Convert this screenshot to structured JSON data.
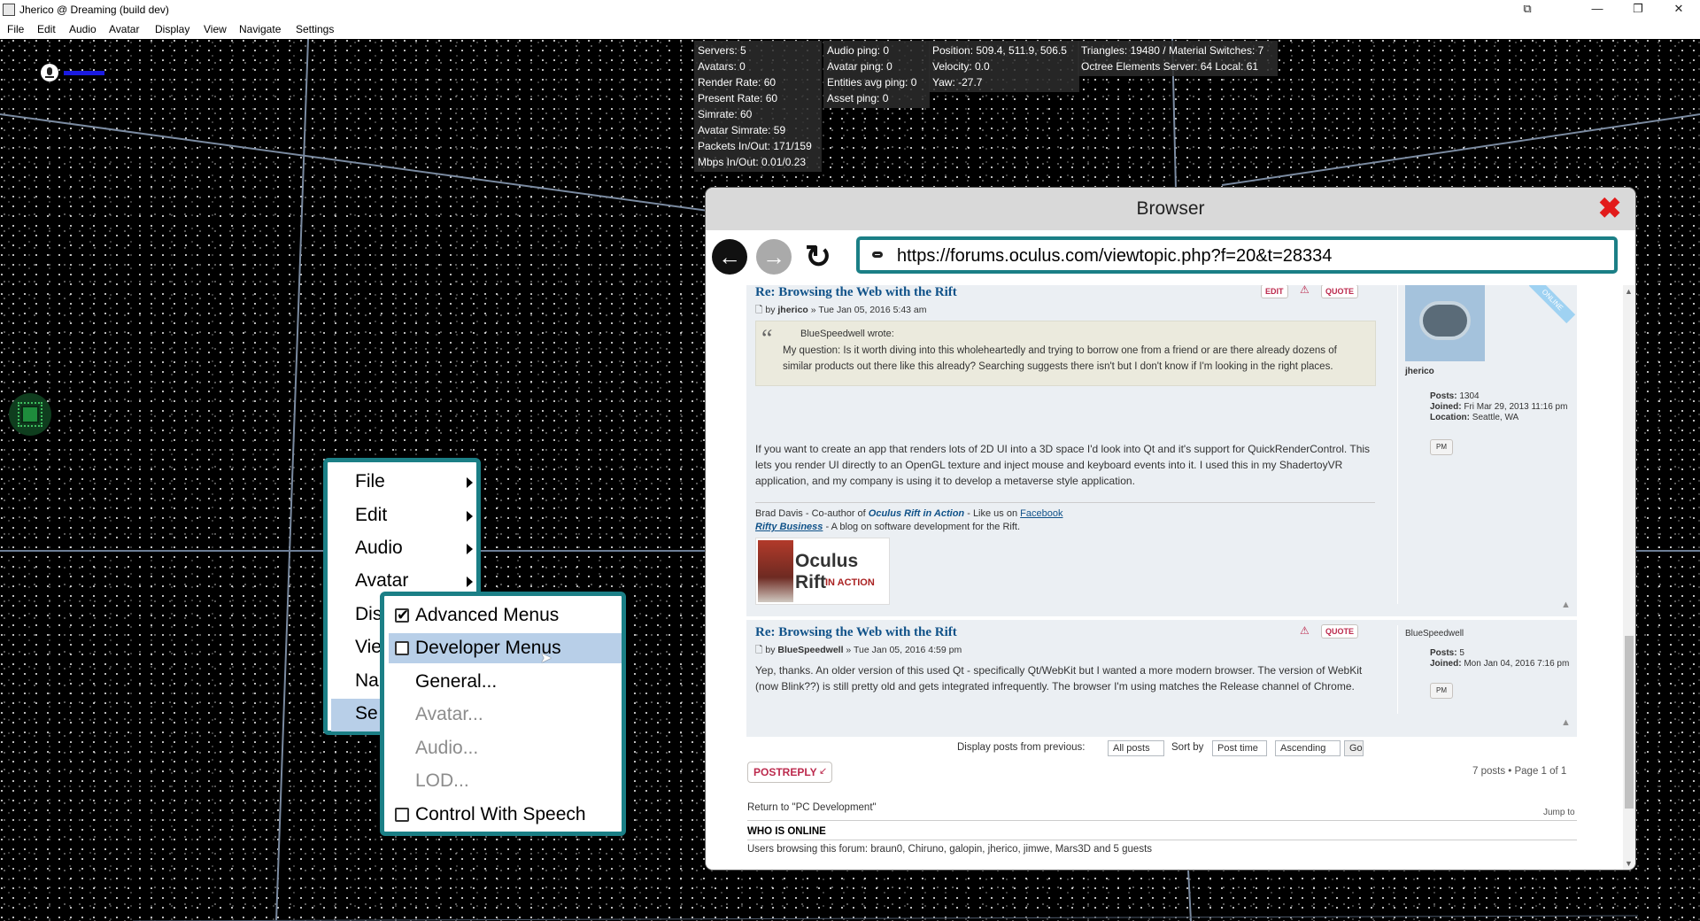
{
  "window": {
    "title": "Jherico @ Dreaming (build dev)",
    "controls": {
      "restore_alt": "⧉",
      "minimize": "—",
      "maximize": "❐",
      "close": "✕"
    }
  },
  "menubar": [
    "File",
    "Edit",
    "Audio",
    "Avatar",
    "Display",
    "View",
    "Navigate",
    "Settings"
  ],
  "stats": {
    "box1": [
      "Servers: 5",
      "Avatars: 0",
      "Render Rate: 60",
      "Present Rate: 60",
      "Simrate: 60",
      "Avatar Simrate: 59",
      "Packets In/Out: 171/159",
      "Mbps In/Out: 0.01/0.23"
    ],
    "box2": [
      "Audio ping: 0",
      "Avatar ping: 0",
      "Entities avg ping: 0",
      "Asset ping: 0"
    ],
    "box3": [
      "Position: 509.4, 511.9, 506.5",
      "Velocity: 0.0",
      "Yaw: -27.7"
    ],
    "box4": [
      "Triangles: 19480 / Material Switches: 7",
      "Octree Elements Server: 64 Local: 61"
    ]
  },
  "main_menu": {
    "items": [
      {
        "label": "File"
      },
      {
        "label": "Edit"
      },
      {
        "label": "Audio"
      },
      {
        "label": "Avatar"
      },
      {
        "label": "Dis"
      },
      {
        "label": "Vie"
      },
      {
        "label": "Na"
      },
      {
        "label": "Se"
      }
    ]
  },
  "settings_submenu": {
    "items": [
      {
        "label": "Advanced Menus",
        "checkbox": true,
        "checked": true,
        "enabled": true
      },
      {
        "label": "Developer Menus",
        "checkbox": true,
        "checked": false,
        "enabled": true,
        "highlighted": true
      },
      {
        "label": "General...",
        "checkbox": false,
        "enabled": true
      },
      {
        "label": "Avatar...",
        "checkbox": false,
        "enabled": false
      },
      {
        "label": "Audio...",
        "checkbox": false,
        "enabled": false
      },
      {
        "label": "LOD...",
        "checkbox": false,
        "enabled": false
      },
      {
        "label": "Control With Speech",
        "checkbox": true,
        "checked": false,
        "enabled": true
      }
    ]
  },
  "browser": {
    "title": "Browser",
    "url": "https://forums.oculus.com/viewtopic.php?f=20&t=28334",
    "post1": {
      "title": "Re: Browsing the Web with the Rift",
      "by": "by",
      "author": "jherico",
      "date": "» Tue Jan 05, 2016 5:43 am",
      "edit_label": "EDIT",
      "quote_label": "QUOTE",
      "quote_author": "BlueSpeedwell wrote:",
      "quote_text": "My question: Is it worth diving into this wholeheartedly and trying to borrow one from a friend or are there already dozens of similar products out there like this already? Searching suggests there isn't but I don't know if I'm looking in the right places.",
      "body": "If you want to create an app that renders lots of 2D UI into a 3D space I'd look into Qt and it's support for QuickRenderControl. This lets you render UI directly to an OpenGL texture and inject mouse and keyboard events into it. I used this in my ShadertoyVR application, and my company is using it to develop a metaverse style application.",
      "sig_prefix": "Brad Davis - Co-author of",
      "sig_book": "Oculus Rift in Action",
      "sig_mid": "- Like us on",
      "sig_fb": "Facebook",
      "sig_blog": "Rifty Business",
      "sig_blog_desc": "- A blog on software development for the Rift.",
      "book_title": "Oculus Rift",
      "book_sub": "IN ACTION",
      "profile": {
        "online": "ONLINE",
        "name": "jherico",
        "posts_label": "Posts:",
        "posts": "1304",
        "joined_label": "Joined:",
        "joined": "Fri Mar 29, 2013 11:16 pm",
        "location_label": "Location:",
        "location": "Seattle, WA",
        "pm": "PM"
      }
    },
    "post2": {
      "title": "Re: Browsing the Web with the Rift",
      "by": "by",
      "author": "BlueSpeedwell",
      "date": "» Tue Jan 05, 2016 4:59 pm",
      "quote_label": "QUOTE",
      "body": "Yep, thanks. An older version of this used Qt - specifically Qt/WebKit but I wanted a more modern browser. The version of WebKit (now Blink??) is still pretty old and gets integrated infrequently. The browser I'm using matches the Release channel of Chrome.",
      "profile": {
        "name": "BlueSpeedwell",
        "posts_label": "Posts:",
        "posts": "5",
        "joined_label": "Joined:",
        "joined": "Mon Jan 04, 2016 7:16 pm",
        "pm": "PM"
      }
    },
    "footer": {
      "display_label": "Display posts from previous:",
      "display_value": "All posts",
      "sort_label": "Sort by",
      "sort_value": "Post time",
      "order_value": "Ascending",
      "go": "Go",
      "postreply": "POSTREPLY",
      "pagination": "7 posts • Page 1 of 1",
      "return_link": "Return to \"PC Development\"",
      "jump_to": "Jump to",
      "who_heading": "WHO IS ONLINE",
      "users_prefix": "Users browsing this forum:",
      "users": "braun0, Chiruno, galopin, jherico, jimwe, Mars3D and 5 guests"
    }
  }
}
